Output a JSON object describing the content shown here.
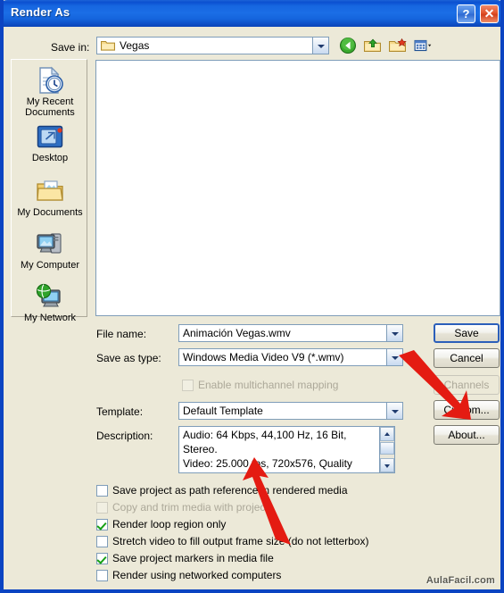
{
  "window": {
    "title": "Render As",
    "help_button": "?",
    "close_button": "✕",
    "accent_color": "#0b44c2",
    "face_color": "#ece9d8"
  },
  "savein": {
    "label": "Save in:",
    "value": "Vegas",
    "toolbar_icons": [
      "back-icon",
      "up-folder-icon",
      "new-folder-icon",
      "views-icon"
    ]
  },
  "places": [
    {
      "label_line1": "My Recent",
      "label_line2": "Documents",
      "icon": "recent-documents-icon"
    },
    {
      "label_line1": "Desktop",
      "label_line2": "",
      "icon": "desktop-icon"
    },
    {
      "label_line1": "My Documents",
      "label_line2": "",
      "icon": "my-documents-icon"
    },
    {
      "label_line1": "My Computer",
      "label_line2": "",
      "icon": "my-computer-icon"
    },
    {
      "label_line1": "My Network",
      "label_line2": "",
      "icon": "my-network-icon"
    }
  ],
  "form": {
    "filename_label": "File name:",
    "filename_value": "Animación Vegas.wmv",
    "savetype_label": "Save as type:",
    "savetype_value": "Windows Media Video V9 (*.wmv)",
    "multichannel_label": "Enable multichannel mapping",
    "template_label": "Template:",
    "template_value": "Default Template",
    "description_label": "Description:",
    "description_lines": [
      "Audio: 64 Kbps, 44,100 Hz, 16 Bit,",
      "Stereo.",
      "Video: 25.000 fps, 720x576, Quality"
    ]
  },
  "buttons": {
    "save": "Save",
    "cancel": "Cancel",
    "channels": "Channels",
    "custom": "Custom...",
    "about": "About..."
  },
  "checkboxes": [
    {
      "label": "Save project as path reference in rendered media",
      "checked": false,
      "disabled": false
    },
    {
      "label": "Copy and trim media with project",
      "checked": false,
      "disabled": true
    },
    {
      "label": "Render loop region only",
      "checked": true,
      "disabled": false
    },
    {
      "label": "Stretch video to fill output frame size (do not letterbox)",
      "checked": false,
      "disabled": false
    },
    {
      "label": "Save project markers in media file",
      "checked": true,
      "disabled": false
    },
    {
      "label": "Render using networked computers",
      "checked": false,
      "disabled": false
    }
  ],
  "annotations": {
    "arrow_color": "#e41b12",
    "arrow_1_target": "custom-button",
    "arrow_2_target": "description-video-line"
  },
  "watermark": "AulaFacil.com"
}
